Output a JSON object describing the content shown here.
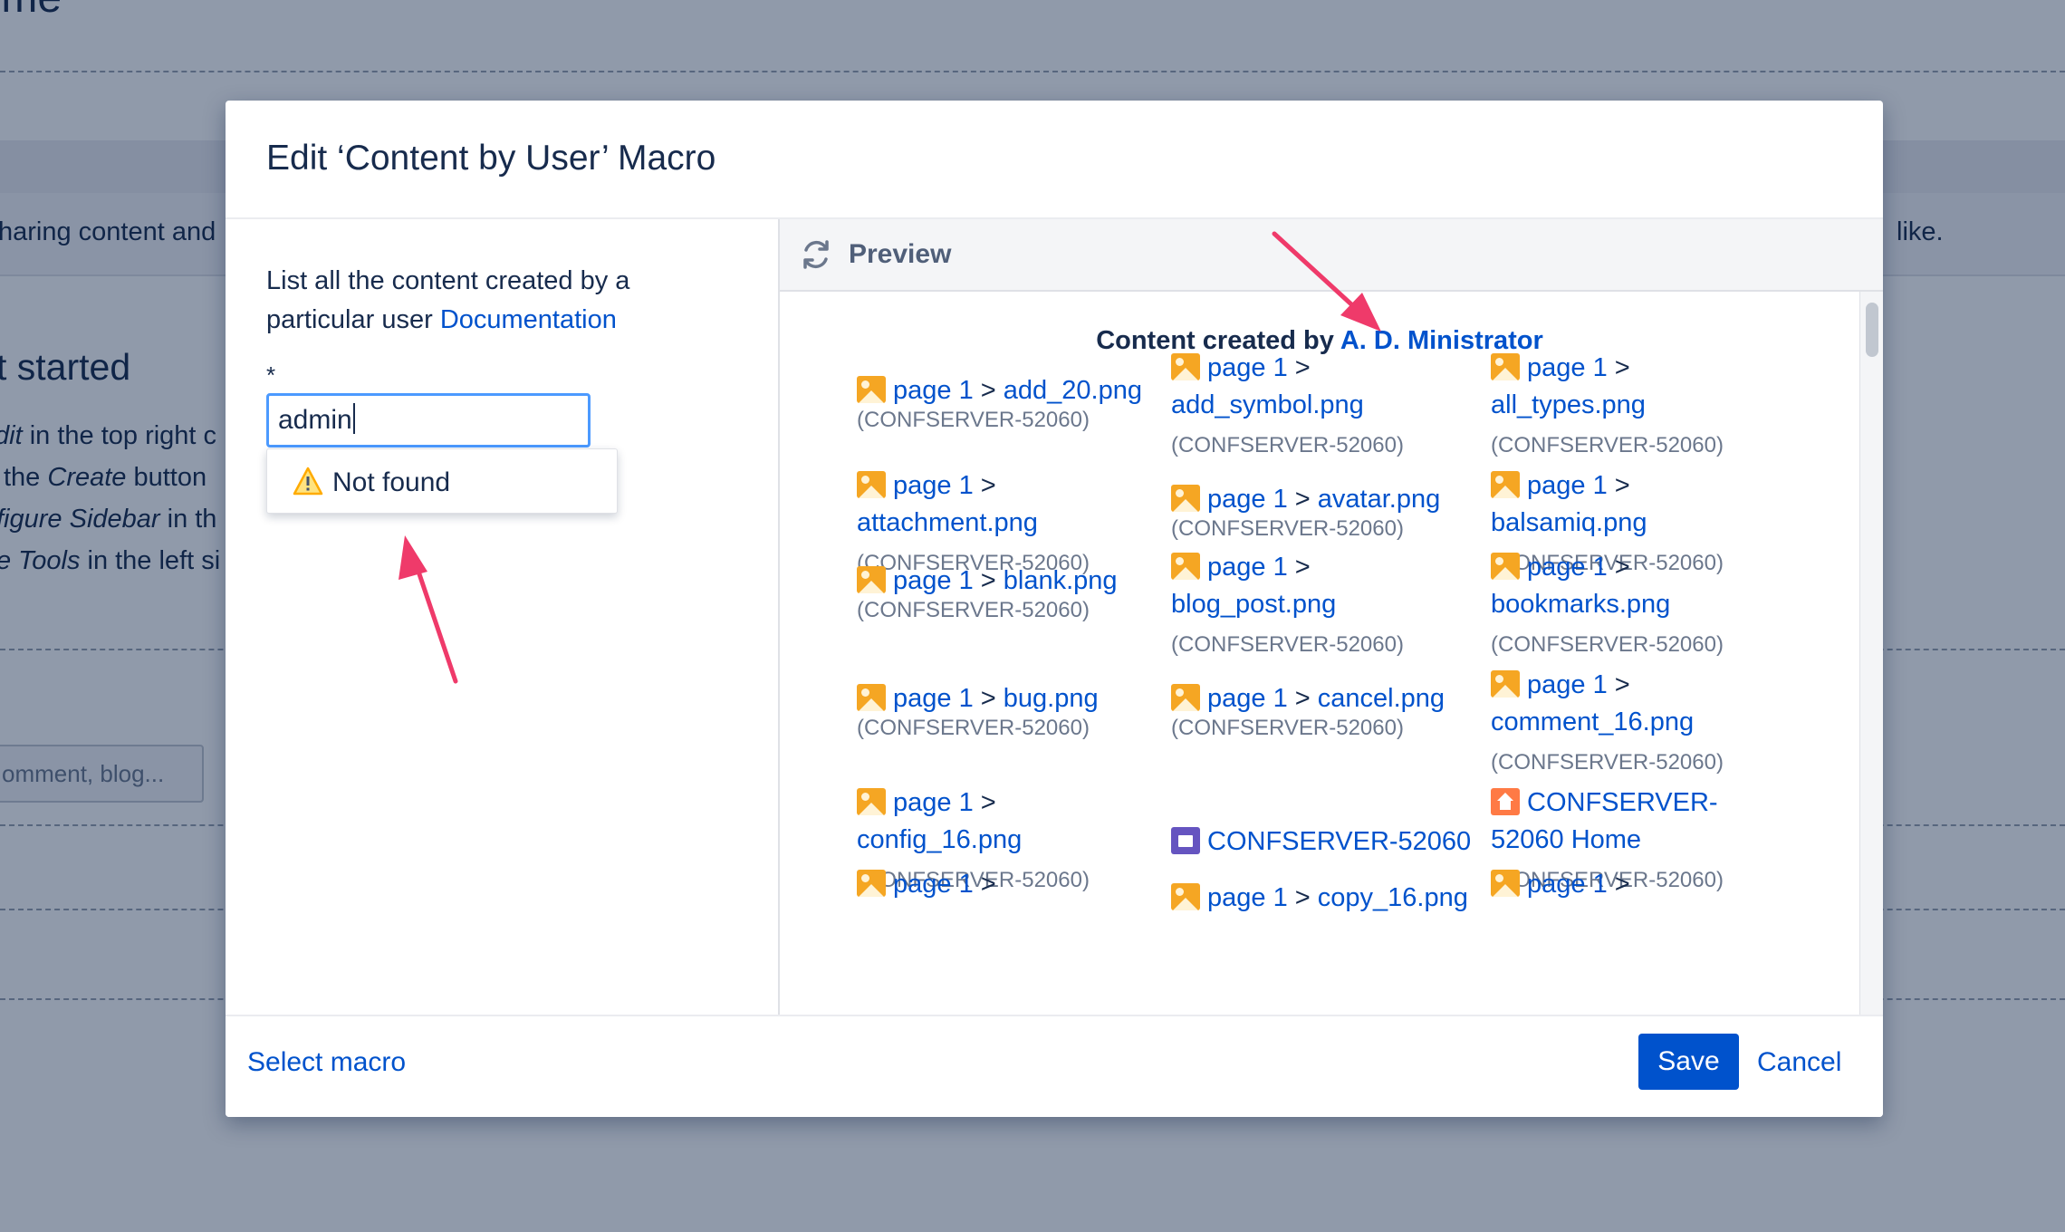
{
  "background_page": {
    "title": "Home",
    "line_intro_left": "haring content and",
    "line_intro_right": "like.",
    "heading": "t started",
    "lines": [
      {
        "italic": "dit",
        "rest": " in the top right c"
      },
      {
        "italic": "",
        "pre": "the ",
        "italic2": "Create",
        "rest": " button"
      },
      {
        "italic": "figure Sidebar",
        "rest": " in th"
      },
      {
        "italic": "e Tools",
        "rest": " in the left si"
      }
    ],
    "comment_placeholder": "omment, blog..."
  },
  "dialog": {
    "title": "Edit ‘Content by User’ Macro",
    "left": {
      "description": "List all the content created by a particular user",
      "doc_link": "Documentation",
      "required_mark": "*",
      "input_value": "admin",
      "dropdown_message": "Not found"
    },
    "preview": {
      "label": "Preview",
      "heading_prefix": "Content created by",
      "heading_user": "A. D. Ministrator",
      "items": [
        {
          "icon": "image-icon",
          "parent": "page 1",
          "sep": ">",
          "title": "add_20.png",
          "space": "(CONFSERVER-52060)"
        },
        {
          "icon": "image-icon",
          "parent": "page 1",
          "sep": ">",
          "title": "add_symbol.png",
          "space": "(CONFSERVER-52060)"
        },
        {
          "icon": "image-icon",
          "parent": "page 1",
          "sep": ">",
          "title": "all_types.png",
          "space": "(CONFSERVER-52060)"
        },
        {
          "icon": "image-icon",
          "parent": "page 1",
          "sep": ">",
          "title": "attachment.png",
          "space": "(CONFSERVER-52060)"
        },
        {
          "icon": "image-icon",
          "parent": "page 1",
          "sep": ">",
          "title": "avatar.png",
          "space": "(CONFSERVER-52060)"
        },
        {
          "icon": "image-icon",
          "parent": "page 1",
          "sep": ">",
          "title": "balsamiq.png",
          "space": "(CONFSERVER-52060)"
        },
        {
          "icon": "image-icon",
          "parent": "page 1",
          "sep": ">",
          "title": "blank.png",
          "space": "(CONFSERVER-52060)"
        },
        {
          "icon": "image-icon",
          "parent": "page 1",
          "sep": ">",
          "title": "blog_post.png",
          "space": "(CONFSERVER-52060)"
        },
        {
          "icon": "image-icon",
          "parent": "page 1",
          "sep": ">",
          "title": "bookmarks.png",
          "space": "(CONFSERVER-52060)"
        },
        {
          "icon": "image-icon",
          "parent": "page 1",
          "sep": ">",
          "title": "bug.png",
          "space": "(CONFSERVER-52060)"
        },
        {
          "icon": "image-icon",
          "parent": "page 1",
          "sep": ">",
          "title": "cancel.png",
          "space": "(CONFSERVER-52060)"
        },
        {
          "icon": "image-icon",
          "parent": "page 1",
          "sep": ">",
          "title": "comment_16.png",
          "space": "(CONFSERVER-52060)"
        },
        {
          "icon": "image-icon",
          "parent": "page 1",
          "sep": ">",
          "title": "config_16.png",
          "space": "(CONFSERVER-52060)"
        },
        {
          "icon": "space-icon",
          "title": "CONFSERVER-52060"
        },
        {
          "icon": "home-icon",
          "title_line1": "CONFSERVER-",
          "title_line2": "52060 Home",
          "space": "(CONFSERVER-52060)"
        },
        {
          "icon": "image-icon",
          "parent": "page 1",
          "sep": ">",
          "title": "copy_16.png"
        },
        {
          "icon": "image-icon",
          "parent": "page 1",
          "sep": ">"
        },
        {
          "icon": "image-icon",
          "parent": "page 1",
          "sep": ">"
        }
      ]
    },
    "footer": {
      "select_macro": "Select macro",
      "save": "Save",
      "cancel": "Cancel"
    }
  },
  "annotations": {
    "arrow_color": "#ef3a6a"
  },
  "colors": {
    "link": "#0052cc",
    "primary_button": "#0052cc",
    "image_icon": "#f5a623",
    "home_icon": "#ff7a45",
    "space_icon": "#6554c0"
  }
}
